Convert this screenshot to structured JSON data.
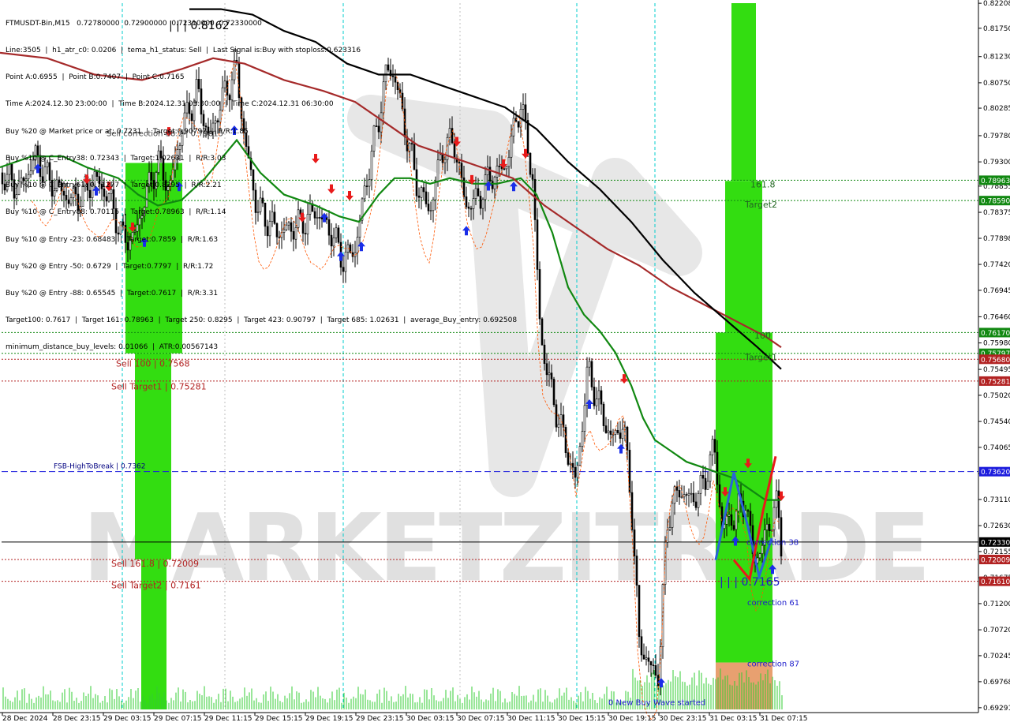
{
  "info_panel": [
    "FTMUSDT-Bin,M15   0.72780000  0.72900000  0.72310000  0.72330000",
    "Line:3505  |  h1_atr_c0: 0.0206  |  tema_h1_status: Sell  |  Last Signal is:Buy with stoploss:0.623316",
    "Point A:0.6955  |  Point B:0.7407  |  Point C:0.7165",
    "Time A:2024.12.30 23:00:00  |  Time B:2024.12.31 03:30:00  |  Time C:2024.12.31 06:30:00",
    "Buy %20 @ Market price or at: 0.7231  |  Target:0.90797  |  R/R:1.85",
    "Buy %10 @ C_Entry38: 0.72343  |  Target:1.02631  |  R/R:3.03",
    "Buy %10 @ C_Entry61: 0.71277  |  Target:0.8295  |  R/R:2.21",
    "Buy %10 @ C_Entry88: 0.70115  |  Target:0.78963  |  R/R:1.14",
    "Buy %10 @ Entry -23: 0.68483  |  Target:0.7859  |  R/R:1.63",
    "Buy %20 @ Entry -50: 0.6729  |  Target:0.7797  |  R/R:1.72",
    "Buy %20 @ Entry -88: 0.65545  |  Target:0.7617  |  R/R:3.31",
    "Target100: 0.7617  |  Target 161: 0.78963  |  Target 250: 0.8295  |  Target 423: 0.90797  |  Target 685: 1.02631  |  average_Buy_entry: 0.692508",
    "minimum_distance_buy_levels: 0.01066  |  ATR:0.00567143"
  ],
  "header_price_label": "| | | 0.8162",
  "watermark": "MARKETZITRADE",
  "colors": {
    "bull": "#000000",
    "bear": "#000000",
    "ma_green": "#118811",
    "ma_brown": "#a52a2a",
    "ma_black": "#000000",
    "zone_green": "#33dd11",
    "zone_orange": "#e8a070",
    "level_green": "#118811",
    "level_red": "#b22222",
    "fsb_blue": "#1c1cdd",
    "volume": "#33cc33",
    "cyan_vline": "#00cccc",
    "arrow_up": "#1a2ee8",
    "arrow_down": "#e81a1a",
    "stop_orange": "#ff5500"
  },
  "chart_data": {
    "type": "line",
    "symbol": "FTMUSDT-Bin",
    "timeframe": "M15",
    "ohlc_current": {
      "open": 0.7278,
      "high": 0.729,
      "low": 0.7231,
      "close": 0.7233
    },
    "ylim": [
      0.6926,
      0.8221
    ],
    "y_ticks": [
      "0.82208",
      "0.81750",
      "0.81230",
      "0.80750",
      "0.80285",
      "0.79780",
      "0.79300",
      "0.78855",
      "0.78375",
      "0.77898",
      "0.77420",
      "0.76945",
      "0.76460",
      "0.75980",
      "0.75495",
      "0.75020",
      "0.74540",
      "0.74065",
      "0.73585",
      "0.73110",
      "0.72630",
      "0.72155",
      "0.71675",
      "0.71200",
      "0.70720",
      "0.70245",
      "0.69768",
      "0.69291"
    ],
    "x_ticks": [
      "28 Dec 2024",
      "28 Dec 23:15",
      "29 Dec 03:15",
      "29 Dec 07:15",
      "29 Dec 11:15",
      "29 Dec 15:15",
      "29 Dec 19:15",
      "29 Dec 23:15",
      "30 Dec 03:15",
      "30 Dec 07:15",
      "30 Dec 11:15",
      "30 Dec 15:15",
      "30 Dec 19:15",
      "30 Dec 23:15",
      "31 Dec 03:15",
      "31 Dec 07:15"
    ],
    "price_path": [
      [
        0,
        0.791
      ],
      [
        25,
        0.788
      ],
      [
        45,
        0.794
      ],
      [
        60,
        0.79
      ],
      [
        75,
        0.788
      ],
      [
        90,
        0.786
      ],
      [
        105,
        0.787
      ],
      [
        120,
        0.79
      ],
      [
        140,
        0.786
      ],
      [
        155,
        0.779
      ],
      [
        170,
        0.779
      ],
      [
        185,
        0.787
      ],
      [
        200,
        0.793
      ],
      [
        215,
        0.788
      ],
      [
        230,
        0.799
      ],
      [
        250,
        0.806
      ],
      [
        265,
        0.797
      ],
      [
        280,
        0.804
      ],
      [
        300,
        0.81
      ],
      [
        310,
        0.797
      ],
      [
        325,
        0.785
      ],
      [
        340,
        0.782
      ],
      [
        355,
        0.78
      ],
      [
        370,
        0.781
      ],
      [
        385,
        0.782
      ],
      [
        400,
        0.784
      ],
      [
        420,
        0.78
      ],
      [
        435,
        0.775
      ],
      [
        450,
        0.777
      ],
      [
        465,
        0.79
      ],
      [
        480,
        0.801
      ],
      [
        490,
        0.81
      ],
      [
        500,
        0.809
      ],
      [
        515,
        0.798
      ],
      [
        530,
        0.788
      ],
      [
        545,
        0.784
      ],
      [
        560,
        0.795
      ],
      [
        575,
        0.797
      ],
      [
        590,
        0.785
      ],
      [
        605,
        0.786
      ],
      [
        620,
        0.79
      ],
      [
        640,
        0.792
      ],
      [
        660,
        0.804
      ],
      [
        675,
        0.79
      ],
      [
        685,
        0.761
      ],
      [
        700,
        0.75
      ],
      [
        715,
        0.742
      ],
      [
        730,
        0.734
      ],
      [
        745,
        0.755
      ],
      [
        760,
        0.748
      ],
      [
        775,
        0.742
      ],
      [
        790,
        0.745
      ],
      [
        800,
        0.731
      ],
      [
        810,
        0.705
      ],
      [
        825,
        0.7
      ],
      [
        835,
        0.699
      ],
      [
        845,
        0.727
      ],
      [
        860,
        0.733
      ],
      [
        875,
        0.731
      ],
      [
        890,
        0.733
      ],
      [
        905,
        0.741
      ],
      [
        915,
        0.726
      ],
      [
        930,
        0.728
      ],
      [
        945,
        0.731
      ],
      [
        955,
        0.72
      ],
      [
        965,
        0.722
      ],
      [
        975,
        0.727
      ],
      [
        985,
        0.73
      ],
      [
        990,
        0.7233
      ]
    ],
    "series": [
      {
        "name": "MA fast (green)",
        "points": [
          [
            0,
            0.792
          ],
          [
            40,
            0.794
          ],
          [
            80,
            0.794
          ],
          [
            110,
            0.792
          ],
          [
            150,
            0.79
          ],
          [
            175,
            0.787
          ],
          [
            200,
            0.785
          ],
          [
            230,
            0.786
          ],
          [
            260,
            0.79
          ],
          [
            300,
            0.797
          ],
          [
            330,
            0.791
          ],
          [
            360,
            0.787
          ],
          [
            400,
            0.785
          ],
          [
            430,
            0.783
          ],
          [
            455,
            0.782
          ],
          [
            480,
            0.787
          ],
          [
            500,
            0.79
          ],
          [
            520,
            0.79
          ],
          [
            545,
            0.789
          ],
          [
            570,
            0.79
          ],
          [
            600,
            0.789
          ],
          [
            630,
            0.789
          ],
          [
            660,
            0.79
          ],
          [
            680,
            0.787
          ],
          [
            700,
            0.78
          ],
          [
            720,
            0.77
          ],
          [
            740,
            0.765
          ],
          [
            760,
            0.762
          ],
          [
            780,
            0.758
          ],
          [
            800,
            0.752
          ],
          [
            815,
            0.746
          ],
          [
            830,
            0.742
          ],
          [
            850,
            0.74
          ],
          [
            870,
            0.738
          ],
          [
            890,
            0.737
          ],
          [
            910,
            0.736
          ],
          [
            930,
            0.735
          ],
          [
            950,
            0.733
          ],
          [
            970,
            0.731
          ],
          [
            990,
            0.731
          ]
        ]
      },
      {
        "name": "MA medium (brown)",
        "points": [
          [
            0,
            0.813
          ],
          [
            60,
            0.812
          ],
          [
            120,
            0.809
          ],
          [
            180,
            0.808
          ],
          [
            230,
            0.81
          ],
          [
            270,
            0.812
          ],
          [
            310,
            0.811
          ],
          [
            360,
            0.808
          ],
          [
            410,
            0.806
          ],
          [
            450,
            0.804
          ],
          [
            490,
            0.8
          ],
          [
            530,
            0.796
          ],
          [
            570,
            0.794
          ],
          [
            610,
            0.792
          ],
          [
            650,
            0.79
          ],
          [
            690,
            0.785
          ],
          [
            730,
            0.781
          ],
          [
            770,
            0.777
          ],
          [
            810,
            0.774
          ],
          [
            850,
            0.77
          ],
          [
            890,
            0.767
          ],
          [
            930,
            0.764
          ],
          [
            970,
            0.761
          ],
          [
            990,
            0.759
          ]
        ]
      },
      {
        "name": "MA slow (black)",
        "points": [
          [
            240,
            0.821
          ],
          [
            280,
            0.821
          ],
          [
            320,
            0.82
          ],
          [
            360,
            0.817
          ],
          [
            400,
            0.815
          ],
          [
            440,
            0.811
          ],
          [
            480,
            0.809
          ],
          [
            520,
            0.809
          ],
          [
            560,
            0.807
          ],
          [
            600,
            0.805
          ],
          [
            640,
            0.803
          ],
          [
            680,
            0.799
          ],
          [
            720,
            0.793
          ],
          [
            760,
            0.788
          ],
          [
            800,
            0.782
          ],
          [
            840,
            0.775
          ],
          [
            880,
            0.769
          ],
          [
            920,
            0.764
          ],
          [
            960,
            0.759
          ],
          [
            990,
            0.755
          ]
        ]
      }
    ],
    "horizontal_levels": [
      {
        "label": "Target 161.8",
        "price": 0.78963,
        "color": "#118811",
        "tag": "0.78963"
      },
      {
        "label": "Target2",
        "price": 0.7859,
        "color": "#118811",
        "tag": "0.78590"
      },
      {
        "label": "Target1 100",
        "price": 0.7617,
        "color": "#118811",
        "tag": "0.76170"
      },
      {
        "label": "",
        "price": 0.7579,
        "color": "#118811",
        "tag": "0.75797"
      },
      {
        "label": "Sell 100",
        "price": 0.7568,
        "color": "#b22222",
        "tag": "0.75680"
      },
      {
        "label": "Sell Target1",
        "price": 0.75281,
        "color": "#b22222",
        "tag": "0.75281"
      },
      {
        "label": "FSB-HighToBreak",
        "price": 0.7362,
        "color": "#1c1cdd",
        "tag": "0.73620"
      },
      {
        "label": "Current",
        "price": 0.7233,
        "color": "#000000",
        "tag": "0.72330"
      },
      {
        "label": "Sell 161.8",
        "price": 0.72009,
        "color": "#b22222",
        "tag": "0.72009"
      },
      {
        "label": "Sell Target2",
        "price": 0.7161,
        "color": "#b22222",
        "tag": "0.71610"
      }
    ],
    "annotations": {
      "sell_correction": "Sell correction 38.2 | 0.79815",
      "sell_100": "Sell 100 | 0.7568",
      "sell_target1": "Sell Target1 | 0.75281",
      "fsb": "FSB-HighToBreak | 0.7362",
      "sell_1618": "Sell 161.8 | 0.72009",
      "sell_target2": "Sell Target2 | 0.7161",
      "target_1618": "161.8",
      "target2": "Target2",
      "target_100": "100",
      "target1": "Target1",
      "correction38": "correction 38",
      "point_c": "| | | 0.7165",
      "correction61": "correction 61",
      "correction87": "correction 87",
      "new_buy_wave": "0 New Buy Wave started"
    },
    "zones": [
      {
        "name": "sell-zone-upper",
        "x0": 159,
        "x1": 231,
        "y0": 0.7928,
        "y1": 0.7579,
        "color": "#33dd11"
      },
      {
        "name": "sell-zone-lower",
        "x0": 171,
        "x1": 217,
        "y0": 0.7579,
        "y1": 0.7201,
        "color": "#33dd11"
      },
      {
        "name": "sell-zone-bottom",
        "x0": 179,
        "x1": 211,
        "y0": 0.7201,
        "y1": 0.6926,
        "color": "#33dd11"
      },
      {
        "name": "buy-zone-top",
        "x0": 927,
        "x1": 958,
        "y0": 0.8221,
        "y1": 0.7895,
        "color": "#33dd11"
      },
      {
        "name": "buy-zone-mid",
        "x0": 919,
        "x1": 966,
        "y0": 0.7895,
        "y1": 0.7617,
        "color": "#33dd11"
      },
      {
        "name": "buy-zone-main",
        "x0": 907,
        "x1": 979,
        "y0": 0.7617,
        "y1": 0.7012,
        "color": "#33dd11"
      },
      {
        "name": "buy-zone-orange",
        "x0": 907,
        "x1": 979,
        "y0": 0.7012,
        "y1": 0.6926,
        "color": "#e8a070"
      }
    ],
    "cyan_vlines_x": [
      155,
      435,
      731,
      830
    ],
    "gray_vlines_x": [
      285,
      583
    ],
    "arrows_up": [
      [
        48,
        0.7918
      ],
      [
        122,
        0.7877
      ],
      [
        183,
        0.7783
      ],
      [
        227,
        0.7885
      ],
      [
        297,
        0.7988
      ],
      [
        411,
        0.7828
      ],
      [
        432,
        0.7757
      ],
      [
        458,
        0.7775
      ],
      [
        591,
        0.7804
      ],
      [
        619,
        0.7886
      ],
      [
        651,
        0.7885
      ],
      [
        747,
        0.7486
      ],
      [
        787,
        0.7404
      ],
      [
        932,
        0.7235
      ],
      [
        979,
        0.7183
      ],
      [
        838,
        0.6975
      ]
    ],
    "arrows_down": [
      [
        400,
        0.7936
      ],
      [
        420,
        0.788
      ],
      [
        383,
        0.7828
      ],
      [
        443,
        0.7868
      ],
      [
        214,
        0.7985
      ],
      [
        168,
        0.781
      ],
      [
        138,
        0.7885
      ],
      [
        110,
        0.7898
      ],
      [
        579,
        0.7967
      ],
      [
        598,
        0.7897
      ],
      [
        638,
        0.7926
      ],
      [
        666,
        0.7945
      ],
      [
        791,
        0.7532
      ],
      [
        919,
        0.7325
      ],
      [
        948,
        0.7377
      ],
      [
        990,
        0.7317
      ]
    ],
    "volume_note": "Green volume histogram along the bottom of the chart"
  }
}
